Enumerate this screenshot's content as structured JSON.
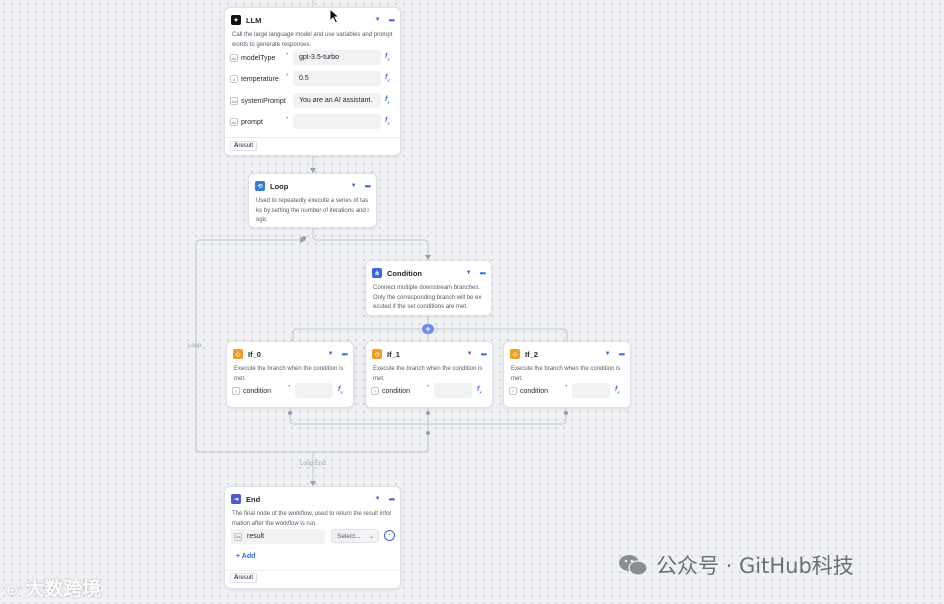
{
  "colors": {
    "accent": "#3a66e6",
    "llm_icon": "#111111",
    "loop_icon": "#3a7bd5",
    "condition_icon": "#3a66e6",
    "if_icon": "#f59a23",
    "end_icon": "#4b5bd6",
    "required": "#e5484d"
  },
  "llm": {
    "title": "LLM",
    "icon": "llm-icon",
    "description": "Call the large language model and use variables and prompt words to generate responses.",
    "params": [
      {
        "name": "modelType",
        "value": "gpt-3.5-turbo",
        "type_icon": "abc-icon"
      },
      {
        "name": "temperature",
        "value": "0.5",
        "type_icon": "number-icon"
      },
      {
        "name": "systemPrompt",
        "value": "You are an AI assistant.",
        "type_icon": "abc-icon"
      },
      {
        "name": "prompt",
        "value": "",
        "type_icon": "abc-icon"
      }
    ],
    "output": "result"
  },
  "loop": {
    "title": "Loop",
    "icon": "loop-icon",
    "description": "Used to repeatedly execute a series of tasks by setting the number of iterations and logic"
  },
  "condition": {
    "title": "Condition",
    "icon": "condition-icon",
    "description": "Connect multiple downstream branches. Only the corresponding branch will be executed if the set conditions are met."
  },
  "branches": [
    {
      "title": "If_0",
      "description": "Execute the branch when the condition is met.",
      "param": "condition"
    },
    {
      "title": "If_1",
      "description": "Execute the branch when the condition is met.",
      "param": "condition"
    },
    {
      "title": "If_2",
      "description": "Execute the branch when the condition is met.",
      "param": "condition"
    }
  ],
  "end": {
    "title": "End",
    "icon": "end-icon",
    "description": "The final node of the workflow, used to return the result information after the workflow is run.",
    "param_name": "result",
    "select_placeholder": "Select...",
    "add_label": "Add",
    "output": "result"
  },
  "wire_labels": {
    "loop": "Loop",
    "loop_end": "Loop End"
  },
  "watermarks": {
    "left": "大数跨境",
    "right": "公众号 · GitHub科技"
  }
}
